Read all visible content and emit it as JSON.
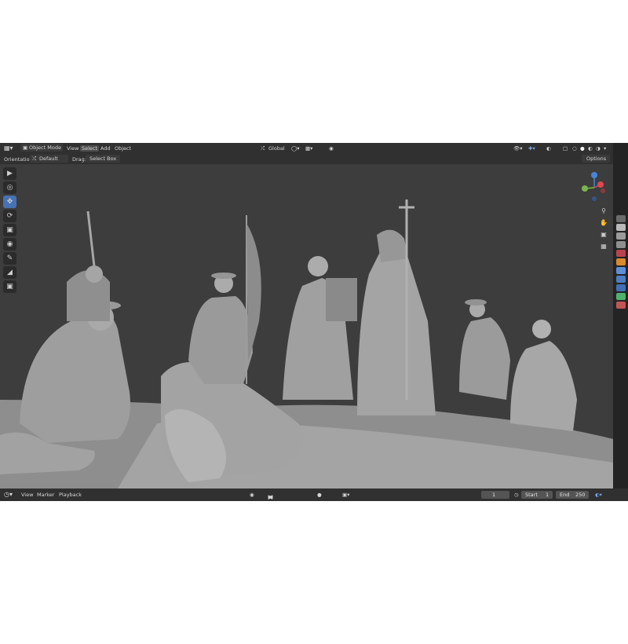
{
  "header": {
    "mode_label": "Object Mode",
    "menus": [
      "View",
      "Select",
      "Add",
      "Object"
    ],
    "active_menu": "Select",
    "orientation_value": "Global"
  },
  "tool_settings": {
    "orientation_label": "Orientation:",
    "orientation_value": "Default",
    "drag_label": "Drag:",
    "drag_value": "Select Box",
    "options_label": "Options"
  },
  "toolbar": {
    "tools": [
      "select-box",
      "cursor",
      "move",
      "rotate",
      "scale",
      "transform",
      "annotate",
      "measure",
      "add-cube"
    ],
    "active_tool": "move"
  },
  "gizmo": {
    "axes": [
      "Z",
      "Y",
      "X"
    ]
  },
  "timeline": {
    "menus": [
      "View",
      "Marker",
      "Playback"
    ],
    "current_frame": "1",
    "start_label": "Start",
    "start_value": "1",
    "end_label": "End",
    "end_value": "250"
  },
  "colors": {
    "accent": "#4772b3",
    "header_bg": "#303030",
    "viewport_bg": "#3d3d3d",
    "axis_x": "#e0474f",
    "axis_y": "#7ab54b",
    "axis_z": "#4a84d8"
  }
}
